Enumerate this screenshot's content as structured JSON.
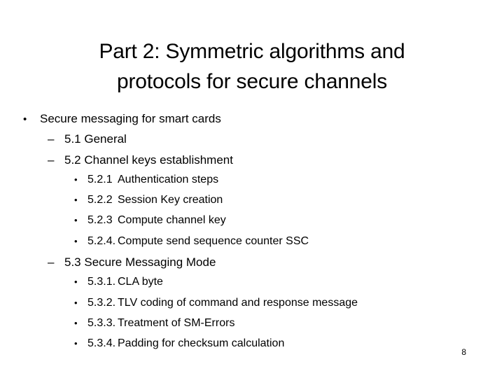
{
  "slide": {
    "title": "Part 2: Symmetric algorithms and\nprotocols for secure channels",
    "page_number": "8",
    "background_color": "#ffffff",
    "text_color": "#000000",
    "markers": {
      "level1": "•",
      "level2": "–",
      "level3": "•"
    },
    "outline": [
      {
        "level": 1,
        "marker": "•",
        "text": "Secure messaging for smart cards"
      },
      {
        "level": 2,
        "marker": "–",
        "text": "5.1 General"
      },
      {
        "level": 2,
        "marker": "–",
        "text": "5.2 Channel keys establishment"
      },
      {
        "level": 3,
        "marker": "•",
        "number": "5.2.1",
        "text": "Authentication steps"
      },
      {
        "level": 3,
        "marker": "•",
        "number": "5.2.2",
        "text": "Session Key creation"
      },
      {
        "level": 3,
        "marker": "•",
        "number": "5.2.3",
        "text": "Compute channel key"
      },
      {
        "level": 3,
        "marker": "•",
        "number": "5.2.4.",
        "text": "Compute send sequence counter SSC"
      },
      {
        "level": 2,
        "marker": "–",
        "text": "5.3 Secure Messaging Mode"
      },
      {
        "level": 3,
        "marker": "•",
        "number": "5.3.1.",
        "text": "CLA byte"
      },
      {
        "level": 3,
        "marker": "•",
        "number": "5.3.2.",
        "text": "TLV coding of command and response message"
      },
      {
        "level": 3,
        "marker": "•",
        "number": "5.3.3.",
        "text": "Treatment of SM-Errors"
      },
      {
        "level": 3,
        "marker": "•",
        "number": "5.3.4.",
        "text": "Padding for checksum calculation"
      }
    ]
  }
}
